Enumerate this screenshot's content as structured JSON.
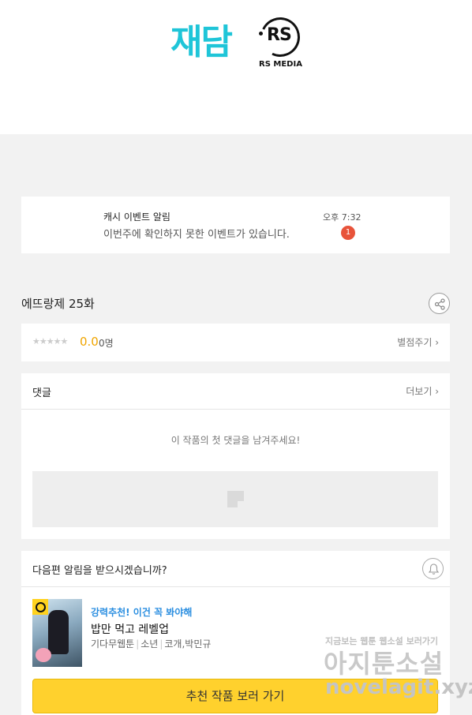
{
  "brand": {
    "jaedam_logo": "재담",
    "rs_logo": "RS",
    "rs_sub": "RS MEDIA"
  },
  "notification": {
    "title": "캐시 이벤트 알림",
    "message": "이번주에 확인하지 못한 이벤트가 있습니다.",
    "time": "오후 7:32",
    "badge": "1"
  },
  "episode": {
    "title": "에뜨랑제 25화",
    "share_icon": "share-icon"
  },
  "rating": {
    "stars": "★★★★★",
    "score": "0.0",
    "count": "0명",
    "rate_link": "별점주기"
  },
  "comments": {
    "title": "댓글",
    "more_link": "더보기",
    "empty_message": "이 작품의 첫 댓글을 남겨주세요!"
  },
  "next_episode": {
    "question": "다음편 알림을 받으시겠습니까?",
    "bell_icon": "bell-icon"
  },
  "recommendation": {
    "label": "강력추천! 이건 꼭 봐야해",
    "title": "밥만 먹고 레벨업",
    "meta": [
      "기다무웹툰",
      "소년",
      "코개,박민규"
    ],
    "button_label": "추천 작품 보러 가기"
  },
  "watermark": {
    "line1": "지금보는 웹툰 웹소설 보러가기",
    "line2": "아지툰소설",
    "line3": "novelagit.xyz"
  },
  "colors": {
    "jaedam_brand": "#1fc5d8",
    "badge_red": "#e8533a",
    "score_orange": "#f0a500",
    "rec_blue": "#2a8ee0",
    "button_yellow": "#ffd12d"
  }
}
